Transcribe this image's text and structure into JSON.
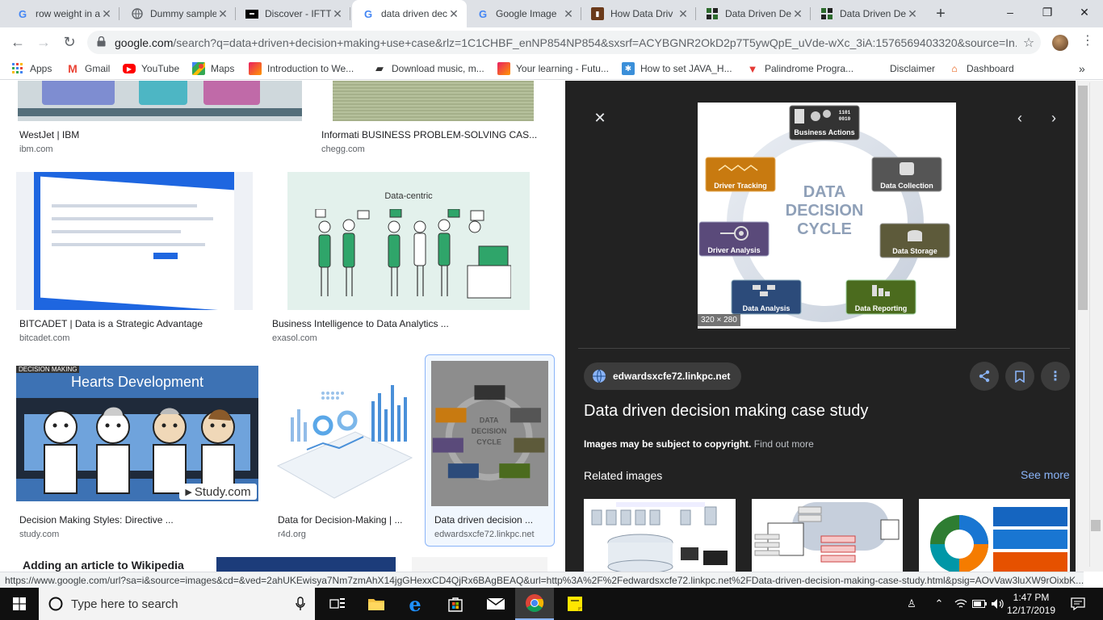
{
  "tabs": [
    {
      "title": "row weight in a",
      "icon": "google-icon"
    },
    {
      "title": "Dummy sample",
      "icon": "globe-icon"
    },
    {
      "title": "Discover - IFTTT",
      "icon": "ifttt-icon"
    },
    {
      "title": "data driven decisio",
      "icon": "google-icon"
    },
    {
      "title": "Google Image",
      "icon": "google-icon"
    },
    {
      "title": "How Data Driv",
      "icon": "book-icon"
    },
    {
      "title": "Data Driven De",
      "icon": "page-icon"
    },
    {
      "title": "Data Driven De",
      "icon": "page-icon"
    }
  ],
  "window": {
    "minimize": "–",
    "maximize": "❐",
    "close": "✕",
    "new_tab": "+"
  },
  "omnibox": {
    "host": "google.com",
    "rest": "/search?q=data+driven+decision+making+use+case&rlz=1C1CHBF_enNP854NP854&sxsrf=ACYBGNR2OkD2p7T5ywQpE_uVde-wXc_3iA:1576569403320&source=In..."
  },
  "bookmarks": [
    {
      "label": "Apps",
      "icon": "apps-grid-icon"
    },
    {
      "label": "Gmail",
      "icon": "gmail-icon"
    },
    {
      "label": "YouTube",
      "icon": "youtube-icon"
    },
    {
      "label": "Maps",
      "icon": "maps-icon"
    },
    {
      "label": "Introduction to We...",
      "icon": "bookmark-site-icon"
    },
    {
      "label": "Download music, m...",
      "icon": "download-icon"
    },
    {
      "label": "Your learning - Futu...",
      "icon": "bookmark-site-icon"
    },
    {
      "label": "How to set JAVA_H...",
      "icon": "bookmark-site-icon"
    },
    {
      "label": "Palindrome Progra...",
      "icon": "bookmark-site-icon"
    },
    {
      "label": "Disclaimer",
      "icon": ""
    },
    {
      "label": "Dashboard",
      "icon": "dashboard-icon"
    }
  ],
  "results": [
    {
      "caption": "WestJet | IBM",
      "source": "ibm.com"
    },
    {
      "caption": "Informati BUSINESS PROBLEM-SOLVING CAS...",
      "source": "chegg.com"
    },
    {
      "caption": "BITCADET | Data is a Strategic Advantage",
      "source": "bitcadet.com"
    },
    {
      "caption": "Business Intelligence to Data Analytics ...",
      "source": "exasol.com"
    },
    {
      "caption": "Decision Making Styles: Directive ...",
      "source": "study.com"
    },
    {
      "caption": "Data for Decision-Making | ...",
      "source": "r4d.org"
    },
    {
      "caption": "Data driven decision ...",
      "source": "edwardsxcfe72.linkpc.net"
    }
  ],
  "thumb_texts": {
    "exasol_label": "Data-centric",
    "study_banner": "DECISION MAKING",
    "study_title": "Hearts Development",
    "study_brand": "Study.com",
    "next_row_title": "Adding an article to Wikipedia"
  },
  "cycle": {
    "center": [
      "DATA",
      "DECISION",
      "CYCLE"
    ],
    "nodes": [
      "Business Actions",
      "Data Collection",
      "Data Storage",
      "Data Reporting",
      "Data Analysis",
      "Driver Analysis",
      "Driver Tracking"
    ],
    "colors": {
      "business": "#333333",
      "collection": "#555555",
      "storage": "#5d5a3a",
      "reporting": "#4b6b1e",
      "analysis": "#2c4b7a",
      "driver_analysis": "#5a4a7a",
      "driver_tracking": "#c87a10"
    }
  },
  "panel": {
    "dimensions": "320 × 280",
    "site": "edwardsxcfe72.linkpc.net",
    "title": "Data driven decision making case study",
    "copyright": "Images may be subject to copyright.",
    "find_out_more": "Find out more",
    "related": "Related images",
    "see_more": "See more"
  },
  "statusbar": "https://www.google.com/url?sa=i&source=images&cd=&ved=2ahUKEwisya7Nm7zmAhX14jgGHexxCD4QjRx6BAgBEAQ&url=http%3A%2F%2Fedwardsxcfe72.linkpc.net%2FData-driven-decision-making-case-study.html&psig=AOvVaw3luXW9rOixbK...",
  "taskbar": {
    "search_placeholder": "Type here to search",
    "time": "1:47 PM",
    "date": "12/17/2019"
  }
}
